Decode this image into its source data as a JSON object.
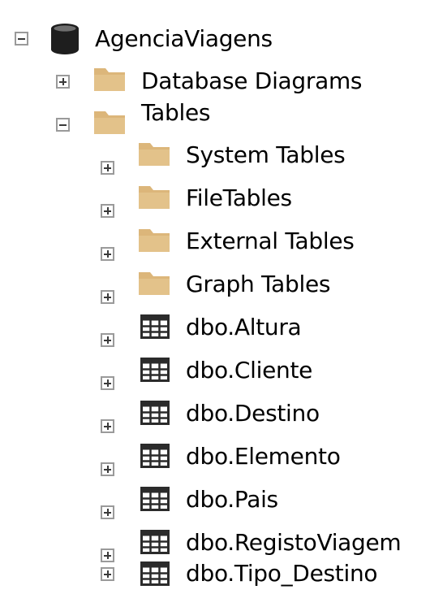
{
  "object_explorer": {
    "database": {
      "label": "AgenciaViagens",
      "state": "expanded",
      "icon": "database-icon"
    },
    "database_children": [
      {
        "label": "Database Diagrams",
        "state": "collapsed",
        "icon": "folder-icon"
      },
      {
        "label": "Tables",
        "state": "expanded",
        "icon": "folder-icon"
      }
    ],
    "table_folders": [
      {
        "label": "System Tables",
        "state": "collapsed",
        "icon": "folder-icon"
      },
      {
        "label": "FileTables",
        "state": "collapsed",
        "icon": "folder-icon"
      },
      {
        "label": "External Tables",
        "state": "collapsed",
        "icon": "folder-icon"
      },
      {
        "label": "Graph Tables",
        "state": "collapsed",
        "icon": "folder-icon"
      }
    ],
    "tables": [
      {
        "label": "dbo.Altura",
        "state": "collapsed",
        "icon": "table-icon"
      },
      {
        "label": "dbo.Cliente",
        "state": "collapsed",
        "icon": "table-icon"
      },
      {
        "label": "dbo.Destino",
        "state": "collapsed",
        "icon": "table-icon"
      },
      {
        "label": "dbo.Elemento",
        "state": "collapsed",
        "icon": "table-icon"
      },
      {
        "label": "dbo.Pais",
        "state": "collapsed",
        "icon": "table-icon"
      },
      {
        "label": "dbo.RegistoViagem",
        "state": "collapsed",
        "icon": "table-icon"
      },
      {
        "label": "dbo.Tipo_Destino",
        "state": "collapsed",
        "icon": "table-icon"
      }
    ],
    "colors": {
      "folder": "#dcb67a",
      "database": "#1e1e1e",
      "table_grid": "#2b2b2b",
      "toggle_border": "#9a9a9a"
    }
  }
}
